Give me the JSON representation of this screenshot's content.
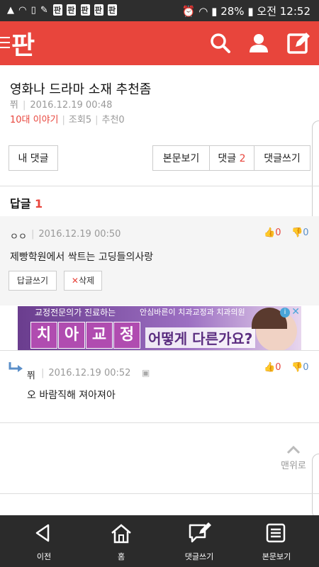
{
  "status_bar": {
    "app_icons": [
      "판",
      "판",
      "판",
      "판",
      "판"
    ],
    "battery": "28%",
    "time": "오전 12:52"
  },
  "header": {
    "logo": "판",
    "icons": [
      "menu-icon",
      "search-icon",
      "user-icon",
      "write-icon"
    ]
  },
  "post": {
    "title": "영화나 드라마 소재 추천좀",
    "author": "쮜",
    "datetime": "2016.12.19 00:48",
    "board": "10대 이야기",
    "views_label": "조회",
    "views": "5",
    "recommend_label": "추천",
    "recommend": "0"
  },
  "actions": {
    "my_comments": "내 댓글",
    "view_original": "본문보기",
    "comments_label": "댓글",
    "comments_count": "2",
    "write_comment": "댓글쓰기"
  },
  "replies": {
    "label": "답글",
    "count": "1"
  },
  "comment1": {
    "author": "ㅇㅇ",
    "datetime": "2016.12.19 00:50",
    "text": "제빵학원에서 싹트는 고딩들의사랑",
    "upvotes": "0",
    "downvotes": "0",
    "reply_button": "답글쓰기",
    "delete_button": "삭제"
  },
  "ad": {
    "line1": "교정전문의가 진료하는",
    "line2": "안심바른이 치과교정과 치과의원",
    "big_chars": [
      "치",
      "아",
      "교",
      "정"
    ],
    "question": "어떻게 다른가요?"
  },
  "comment2": {
    "author": "쮜",
    "datetime": "2016.12.19 00:52",
    "text": "오 바람직해 져아져아",
    "upvotes": "0",
    "downvotes": "0"
  },
  "top_button": "맨위로",
  "bottom_nav": [
    {
      "label": "이전",
      "icon": "back-icon"
    },
    {
      "label": "홈",
      "icon": "home-icon"
    },
    {
      "label": "댓글쓰기",
      "icon": "comment-write-icon"
    },
    {
      "label": "본문보기",
      "icon": "document-icon"
    }
  ],
  "colors": {
    "brand": "#e8453c",
    "down_vote": "#5b8fc9",
    "nav_bg": "#2b2b2b"
  }
}
